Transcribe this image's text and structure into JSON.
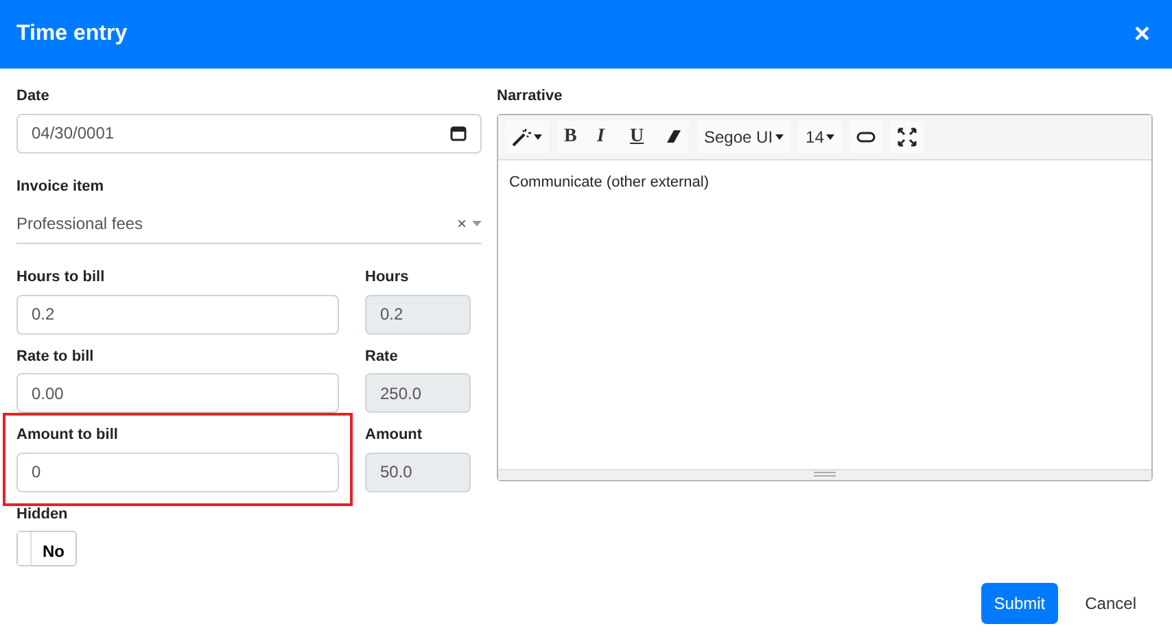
{
  "dialog": {
    "title": "Time entry",
    "close": "×"
  },
  "date": {
    "label": "Date",
    "value": "04/30/0001"
  },
  "invoice_item": {
    "label": "Invoice item",
    "value": "Professional fees",
    "clear": "×"
  },
  "amount_rows": [
    {
      "label": "Hours to bill",
      "value": "0.2",
      "side_label": "Hours",
      "side_value": "0.2",
      "highlighted": false
    },
    {
      "label": "Rate to bill",
      "value": "0.00",
      "side_label": "Rate",
      "side_value": "250.0",
      "highlighted": false
    },
    {
      "label": "Amount to bill",
      "value": "0",
      "side_label": "Amount",
      "side_value": "50.0",
      "highlighted": true
    }
  ],
  "hidden": {
    "label": "Hidden",
    "text": "No",
    "on": false
  },
  "narrative": {
    "label": "Narrative",
    "text": "Communicate (other external)",
    "toolbar": [
      {
        "kind": "wand"
      },
      {
        "kind": "bold",
        "text": "B"
      },
      {
        "kind": "italic",
        "text": "I"
      },
      {
        "kind": "underline",
        "text": "U"
      },
      {
        "kind": "eraser"
      },
      {
        "kind": "dropdown",
        "text": "Segoe UI"
      },
      {
        "kind": "dropdown",
        "text": "14"
      },
      {
        "kind": "link"
      },
      {
        "kind": "fullscreen"
      }
    ]
  },
  "buttons": {
    "submit": "Submit",
    "cancel": "Cancel"
  }
}
